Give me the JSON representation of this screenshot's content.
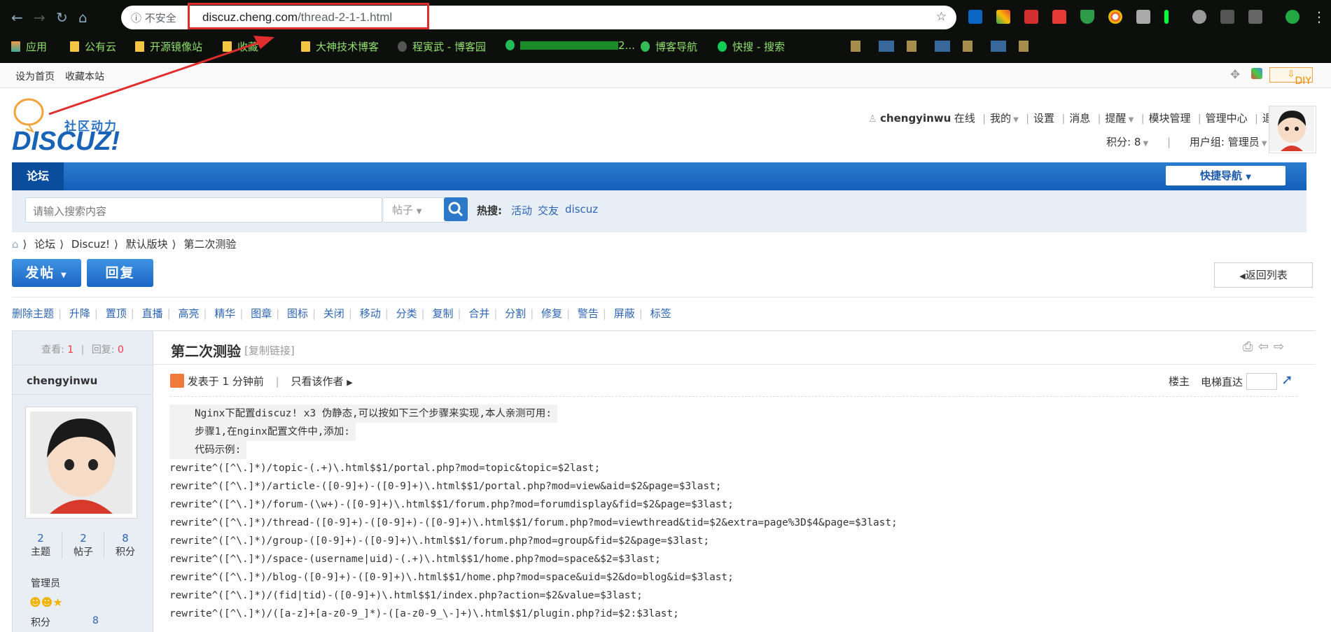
{
  "browser": {
    "security_label": "不安全",
    "url_host": "discuz.cheng.com",
    "url_path": "/thread-2-1-1.html",
    "bookmarks": [
      "应用",
      "公有云",
      "开源镜像站",
      "收藏",
      "大神技术博客",
      "程寅武 - 博客园",
      "2...",
      "博客导航",
      "快搜 - 搜索"
    ]
  },
  "topbar": {
    "set_home": "设为首页",
    "favorite": "收藏本站",
    "diy": "DIY"
  },
  "logo": {
    "slogan": "社区动力",
    "brand": "DISCUZ!"
  },
  "user": {
    "name": "chengyinwu",
    "status": "在线",
    "links": [
      "我的",
      "设置",
      "消息",
      "提醒",
      "模块管理",
      "管理中心",
      "退出"
    ],
    "points": "积分: 8",
    "group": "用户组: 管理员"
  },
  "nav": {
    "forum": "论坛",
    "quick_nav": "快捷导航"
  },
  "search": {
    "placeholder": "请输入搜索内容",
    "type": "帖子",
    "hot_label": "热搜:",
    "hot": [
      "活动",
      "交友",
      "discuz"
    ]
  },
  "breadcrumb": [
    "论坛",
    "Discuz!",
    "默认版块",
    "第二次测验"
  ],
  "actions": {
    "post": "发帖",
    "reply": "回复",
    "back": "返回列表"
  },
  "mod_tools": [
    "删除主题",
    "升降",
    "置顶",
    "直播",
    "高亮",
    "精华",
    "图章",
    "图标",
    "关闭",
    "移动",
    "分类",
    "复制",
    "合并",
    "分割",
    "修复",
    "警告",
    "屏蔽",
    "标签"
  ],
  "thread": {
    "views_label": "查看:",
    "views": "1",
    "replies_label": "回复:",
    "replies": "0",
    "title": "第二次测验",
    "copy_link": "[复制链接]",
    "author": "chengyinwu",
    "posted": "发表于 1 分钟前",
    "only_author": "只看该作者",
    "floor": "楼主",
    "jump": "电梯直达",
    "stats": [
      {
        "value": "2",
        "label": "主题"
      },
      {
        "value": "2",
        "label": "帖子"
      },
      {
        "value": "8",
        "label": "积分"
      }
    ],
    "group": "管理员",
    "points_label": "积分",
    "points_value": "8",
    "body": [
      "Nginx下配置discuz! x3 伪静态,可以按如下三个步骤来实现,本人亲测可用:",
      "步骤1,在nginx配置文件中,添加:",
      "代码示例:"
    ],
    "code": [
      "rewrite^([^\\.]*)/topic-(.+)\\.html$$1/portal.php?mod=topic&topic=$2last;",
      "rewrite^([^\\.]*)/article-([0-9]+)-([0-9]+)\\.html$$1/portal.php?mod=view&aid=$2&page=$3last;",
      "rewrite^([^\\.]*)/forum-(\\w+)-([0-9]+)\\.html$$1/forum.php?mod=forumdisplay&fid=$2&page=$3last;",
      "rewrite^([^\\.]*)/thread-([0-9]+)-([0-9]+)-([0-9]+)\\.html$$1/forum.php?mod=viewthread&tid=$2&extra=page%3D$4&page=$3last;",
      "rewrite^([^\\.]*)/group-([0-9]+)-([0-9]+)\\.html$$1/forum.php?mod=group&fid=$2&page=$3last;",
      "rewrite^([^\\.]*)/space-(username|uid)-(.+)\\.html$$1/home.php?mod=space&$2=$3last;",
      "rewrite^([^\\.]*)/blog-([0-9]+)-([0-9]+)\\.html$$1/home.php?mod=space&uid=$2&do=blog&id=$3last;",
      "rewrite^([^\\.]*)/(fid|tid)-([0-9]+)\\.html$$1/index.php?action=$2&value=$3last;",
      "rewrite^([^\\.]*)/([a-z]+[a-z0-9_]*)-([a-z0-9_\\-]+)\\.html$$1/plugin.php?id=$2:$3last;"
    ]
  },
  "colors": {
    "nav_blue": "#1260b8",
    "link": "#2d65b5",
    "annotation_red": "#e02d2d"
  }
}
